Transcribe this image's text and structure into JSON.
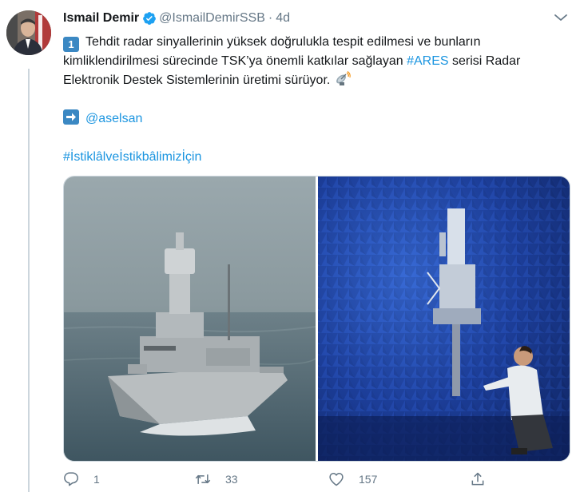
{
  "tweet": {
    "author_name": "Ismail Demir",
    "handle": "@IsmailDemirSSB",
    "separator": "·",
    "time": "4d",
    "verified": true,
    "badge_number": "1",
    "text_line1": "Tehdit radar sinyallerinin yüksek doğrulukla tespit edilmesi ve bunların kimliklendirilmesi sürecinde TSK’ya önemli katkılar sağlayan ",
    "hashtag_ares": "#ARES",
    "text_line2": " serisi Radar Elektronik Destek Sistemlerinin üretimi sürüyor. ",
    "mention": "@aselsan",
    "hashtag_istiklal": "#İstiklâlveİstikbâlimizİçin"
  },
  "media": [
    {
      "description_icon": "warship-photo"
    },
    {
      "description_icon": "anechoic-chamber-photo"
    }
  ],
  "actions": {
    "reply_count": "1",
    "retweet_count": "33",
    "like_count": "157"
  },
  "colors": {
    "link": "#1b95e0",
    "secondary_text": "#657786",
    "verified": "#1da1f2",
    "emoji_box": "#3b88c3"
  }
}
